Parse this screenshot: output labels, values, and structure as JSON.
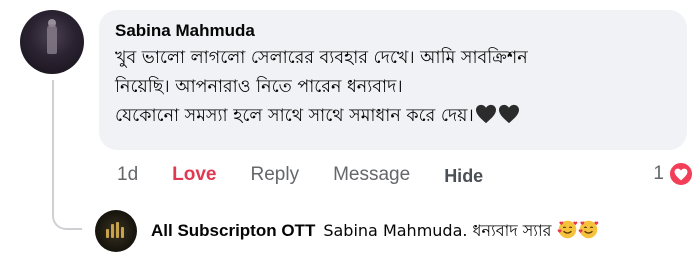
{
  "comment": {
    "author": "Sabina Mahmuda",
    "lines": [
      "খুব ভালো লাগলো সেলারের ব্যবহার দেখে। আমি সাবক্রিশন",
      "নিয়েছি। আপনারাও নিতে পারেন ধন্যবাদ।",
      "যেকোনো সমস্যা হলে সাথে সাথে সমাধান করে দেয়।"
    ],
    "trailing_emojis": [
      "black-heart",
      "black-heart"
    ],
    "age": "1d",
    "actions": {
      "love": "Love",
      "reply": "Reply",
      "message": "Message",
      "hide": "Hide"
    },
    "reaction_count": "1",
    "reaction_type": "love",
    "love_color": "#e03a52"
  },
  "reply": {
    "author": "All Subscripton OTT",
    "text": "Sabina Mahmuda. ধন্যবাদ স্যার",
    "trailing_emojis": [
      "smiling-face-with-hearts",
      "smiling-face-with-hearts"
    ]
  }
}
